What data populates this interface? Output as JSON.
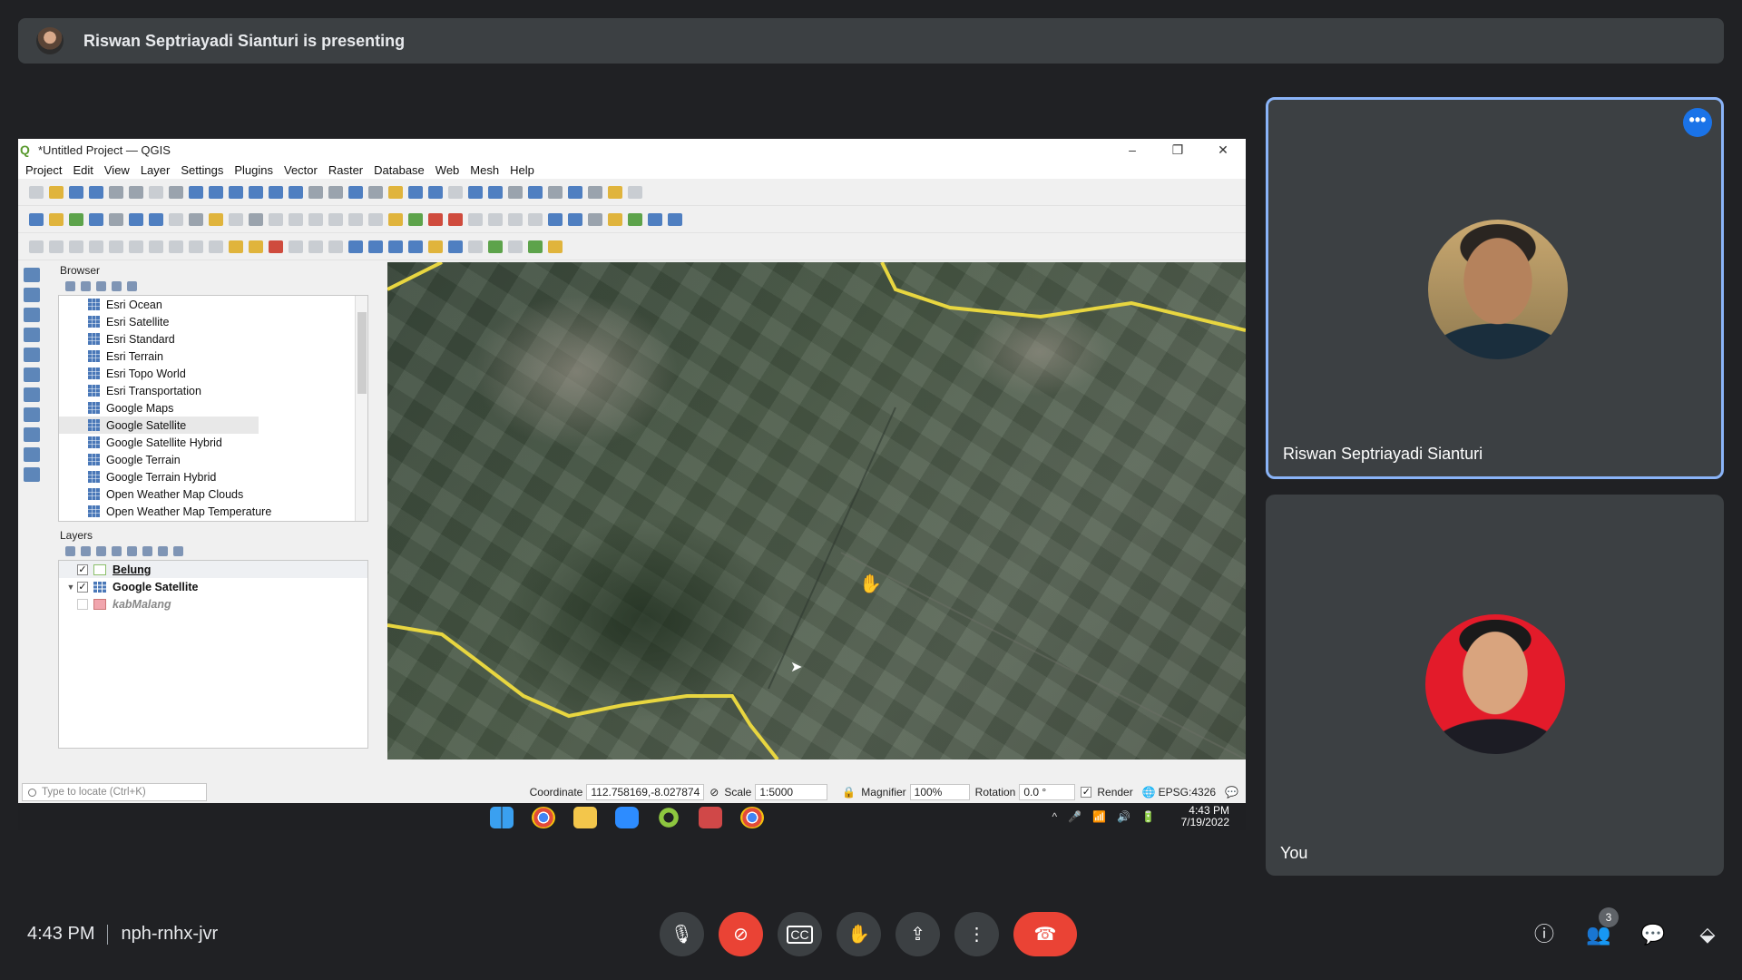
{
  "banner": {
    "text": "Riswan Septriayadi Sianturi is presenting"
  },
  "qgis": {
    "window_title": "*Untitled Project — QGIS",
    "menu": [
      "Project",
      "Edit",
      "View",
      "Layer",
      "Settings",
      "Plugins",
      "Vector",
      "Raster",
      "Database",
      "Web",
      "Mesh",
      "Help"
    ],
    "browser_title": "Browser",
    "browser_items": [
      "Esri Ocean",
      "Esri Satellite",
      "Esri Standard",
      "Esri Terrain",
      "Esri Topo World",
      "Esri Transportation",
      "Google Maps",
      "Google Satellite",
      "Google Satellite Hybrid",
      "Google Terrain",
      "Google Terrain Hybrid",
      "Open Weather Map Clouds",
      "Open Weather Map Temperature"
    ],
    "browser_selected": "Google Satellite",
    "layers_title": "Layers",
    "layers": [
      {
        "name": "Belung",
        "checked": true
      },
      {
        "name": "Google Satellite",
        "checked": true
      },
      {
        "name": "kabMalang",
        "checked": false
      }
    ],
    "status": {
      "locate_placeholder": "Type to locate (Ctrl+K)",
      "coordinate_label": "Coordinate",
      "coordinate_value": "112.758169,-8.027874",
      "scale_label": "Scale",
      "scale_value": "1:5000",
      "magnifier_label": "Magnifier",
      "magnifier_value": "100%",
      "rotation_label": "Rotation",
      "rotation_value": "0.0 °",
      "render_label": "Render",
      "crs": "EPSG:4326"
    }
  },
  "windows_taskbar": {
    "time": "4:43 PM",
    "date": "7/19/2022"
  },
  "participants": [
    {
      "name": "Riswan Septriayadi Sianturi",
      "active_speaker": true
    },
    {
      "name": "You",
      "active_speaker": false
    }
  ],
  "bottom_bar": {
    "time": "4:43 PM",
    "meeting_code": "nph-rnhx-jvr",
    "participant_count": "3"
  },
  "colors": {
    "background": "#202124",
    "tile": "#3c4043",
    "active_border": "#8ab4f8",
    "end_call": "#ea4335",
    "boundary_line": "#e8d640"
  }
}
